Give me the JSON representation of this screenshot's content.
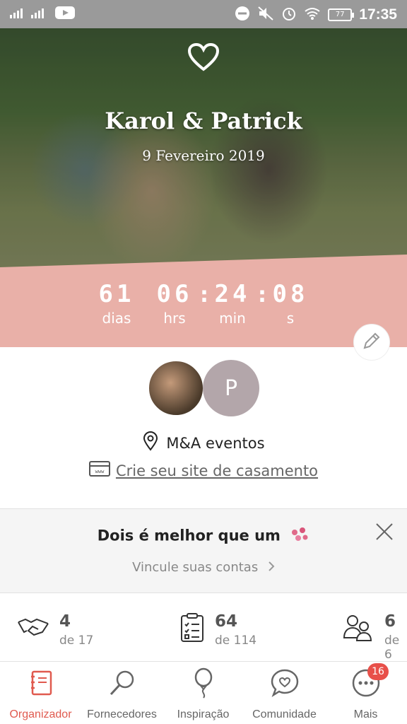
{
  "status_bar": {
    "time": "17:35",
    "battery": "77"
  },
  "hero": {
    "couple_names": "Karol & Patrick",
    "date": "9 Fevereiro 2019"
  },
  "countdown": {
    "days": "61",
    "days_label": "dias",
    "hours": "06",
    "hours_label": "hrs",
    "minutes": "24",
    "minutes_label": "min",
    "seconds": "08",
    "seconds_label": "s"
  },
  "profile": {
    "partner_initial": "P",
    "location": "M&A eventos",
    "website_link": "Crie seu site de casamento"
  },
  "link_card": {
    "title": "Dois é melhor que um",
    "cta": "Vincule suas contas"
  },
  "stats": [
    {
      "icon": "handshake-icon",
      "value": "4",
      "total": "de 17"
    },
    {
      "icon": "checklist-icon",
      "value": "64",
      "total": "de 114"
    },
    {
      "icon": "guests-icon",
      "value": "6",
      "total": "de 6"
    }
  ],
  "nav": {
    "items": [
      {
        "label": "Organizador",
        "icon": "notebook-icon"
      },
      {
        "label": "Fornecedores",
        "icon": "magnifier-icon"
      },
      {
        "label": "Inspiração",
        "icon": "balloon-icon"
      },
      {
        "label": "Comunidade",
        "icon": "chat-heart-icon"
      },
      {
        "label": "Mais",
        "icon": "more-icon"
      }
    ],
    "badge": "16"
  },
  "colors": {
    "accent": "#e05a4f",
    "countdown_bg": "#e9b0a8",
    "statusbar_bg": "#9a9a9a"
  }
}
